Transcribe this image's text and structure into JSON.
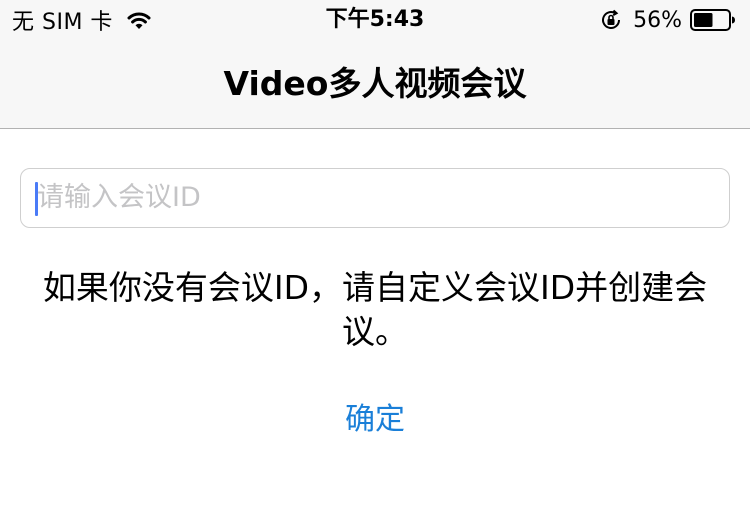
{
  "status_bar": {
    "carrier": "无 SIM 卡",
    "wifi_icon": "wifi-icon",
    "time": "下午5:43",
    "rotation_lock_icon": "rotation-lock-icon",
    "battery_percent": "56%",
    "battery_level": 0.56,
    "battery_icon": "battery-icon"
  },
  "nav": {
    "title": "Video多人视频会议"
  },
  "form": {
    "meeting_id_value": "",
    "meeting_id_placeholder": "请输入会议ID",
    "hint": "如果你没有会议ID，请自定义会议ID并创建会议。",
    "confirm_label": "确定"
  },
  "colors": {
    "accent": "#1a7fd8",
    "caret": "#4a7bf7",
    "placeholder": "#c4c4c6",
    "bar_background": "#f7f7f7"
  }
}
